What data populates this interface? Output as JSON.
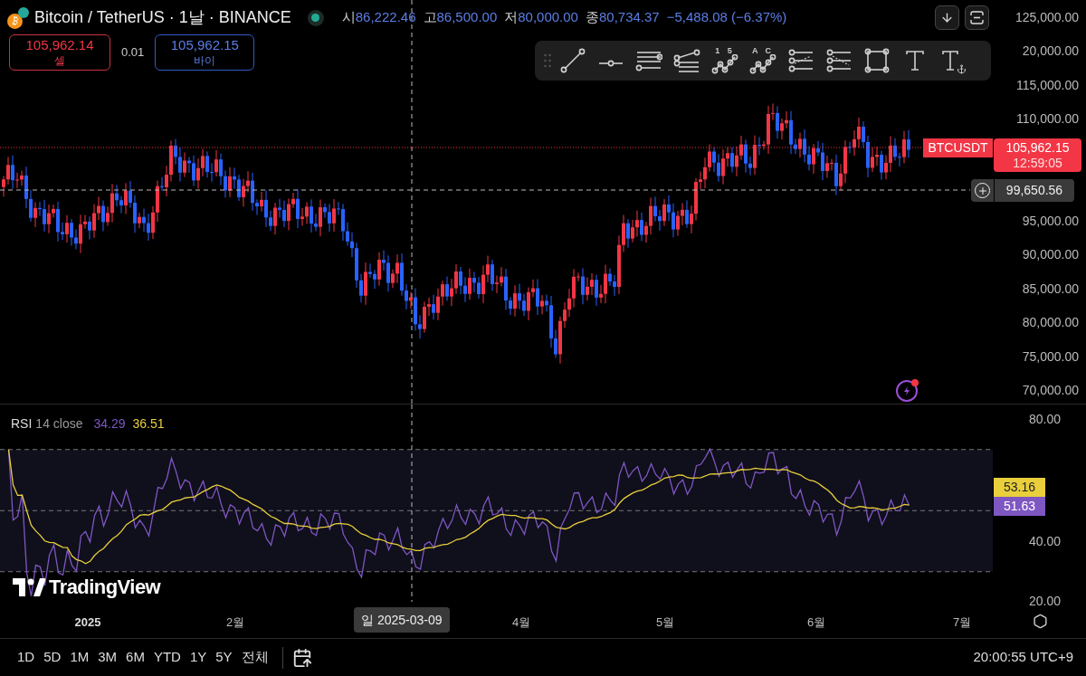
{
  "header": {
    "title": "Bitcoin / TetherUS · 1날 · BINANCE",
    "ohlc": [
      {
        "label": "시",
        "value": "86,222.46"
      },
      {
        "label": "고",
        "value": "86,500.00"
      },
      {
        "label": "저",
        "value": "80,000.00"
      },
      {
        "label": "종",
        "value": "80,734.37"
      }
    ],
    "change": "−5,488.08 (−6.37%)"
  },
  "trade": {
    "sell": {
      "price": "105,962.14",
      "label": "셀"
    },
    "spread": "0.01",
    "buy": {
      "price": "105,962.15",
      "label": "바이"
    }
  },
  "drawing_tools": [
    {
      "kind": "handle"
    },
    {
      "kind": "trend"
    },
    {
      "kind": "ray"
    },
    {
      "kind": "fib"
    },
    {
      "kind": "fan"
    },
    {
      "kind": "pattern",
      "marks": "1 5"
    },
    {
      "kind": "pattern",
      "marks": "A C"
    },
    {
      "kind": "projection"
    },
    {
      "kind": "projection2"
    },
    {
      "kind": "rectangle"
    },
    {
      "kind": "text"
    },
    {
      "kind": "anchored-text"
    }
  ],
  "price_axis": [
    "125,000.00",
    "20,000.00",
    "115,000.00",
    "110,000.00",
    "95,000.00",
    "90,000.00",
    "85,000.00",
    "80,000.00",
    "75,000.00",
    "70,000.00"
  ],
  "symbol_label": "BTCUSDT",
  "last_price": "105,962.15",
  "countdown": "12:59:05",
  "crosshair_price": "99,650.56",
  "rsi": {
    "name": "RSI",
    "params": "14 close",
    "value": "34.29",
    "ma_value": "36.51",
    "axis": [
      "80.00",
      "40.00",
      "20.00"
    ],
    "ma_label": "53.16",
    "rsi_label": "51.63"
  },
  "logo": "TradingView",
  "time_axis": {
    "labels": [
      {
        "text": "2025",
        "kind": "year"
      },
      {
        "text": "2월",
        "kind": "month"
      },
      {
        "text": "4월",
        "kind": "month"
      },
      {
        "text": "5월",
        "kind": "month"
      },
      {
        "text": "6월",
        "kind": "month"
      },
      {
        "text": "7월",
        "kind": "month"
      }
    ],
    "crosshair_date": "일 2025-03-09"
  },
  "ranges": [
    "1D",
    "5D",
    "1M",
    "3M",
    "6M",
    "YTD",
    "1Y",
    "5Y",
    "전체"
  ],
  "clock": "20:00:55 UTC+9"
}
